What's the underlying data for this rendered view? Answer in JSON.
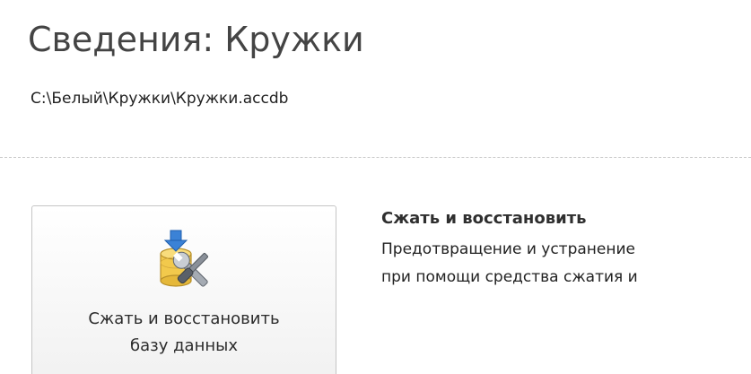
{
  "header": {
    "title": "Сведения: Кружки",
    "file_path": "C:\\Белый\\Кружки\\Кружки.accdb"
  },
  "compact_repair": {
    "button_label_line1": "Сжать и восстановить",
    "button_label_line2": "базу данных",
    "icon": "compact-repair-database-icon",
    "heading": "Сжать и восстановить",
    "description_line1": "Предотвращение и устранение",
    "description_line2": "при помощи средства сжатия и"
  },
  "colors": {
    "icon_arrow": "#3b82d6",
    "icon_database": "#f2c94c",
    "icon_tools": "#8a9099"
  }
}
